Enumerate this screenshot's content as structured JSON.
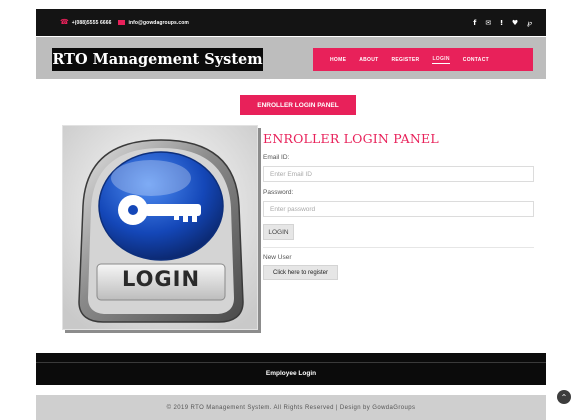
{
  "topbar": {
    "phone_icon": "phone-icon",
    "phone": "+(088)5555 6666",
    "email_icon": "envelope-icon",
    "email": "info@gowdagroups.com",
    "social": [
      {
        "name": "facebook-icon",
        "glyph": "f"
      },
      {
        "name": "mail-icon",
        "glyph": "■"
      },
      {
        "name": "rss-icon",
        "glyph": "\u0001"
      },
      {
        "name": "twitter-icon",
        "glyph": "▾"
      },
      {
        "name": "pinterest-icon",
        "glyph": "P"
      }
    ]
  },
  "header": {
    "brand": "RTO Management System",
    "nav": [
      "HOME",
      "ABOUT",
      "REGISTER",
      "LOGIN",
      "CONTACT"
    ],
    "active_nav": "LOGIN"
  },
  "main": {
    "panel_button": "ENROLLER LOGIN PANEL",
    "image_caption": "LOGIN",
    "form": {
      "title": "ENROLLER LOGIN PANEL",
      "email_label": "Email ID:",
      "email_placeholder": "Enter Email ID",
      "password_label": "Password:",
      "password_placeholder": "Enter password",
      "login_button": "LOGIN",
      "new_user_label": "New User",
      "register_button": "Click here to register"
    }
  },
  "footer": {
    "employee_link": "Employee Login",
    "copyright": "© 2019 RTO Management System. All Rights Reserved | Design by GowdaGroups",
    "to_top_icon": "chevron-up-icon"
  },
  "colors": {
    "accent": "#e8215a",
    "dark": "#0b0b0b",
    "header_band": "#bdbdbd"
  }
}
